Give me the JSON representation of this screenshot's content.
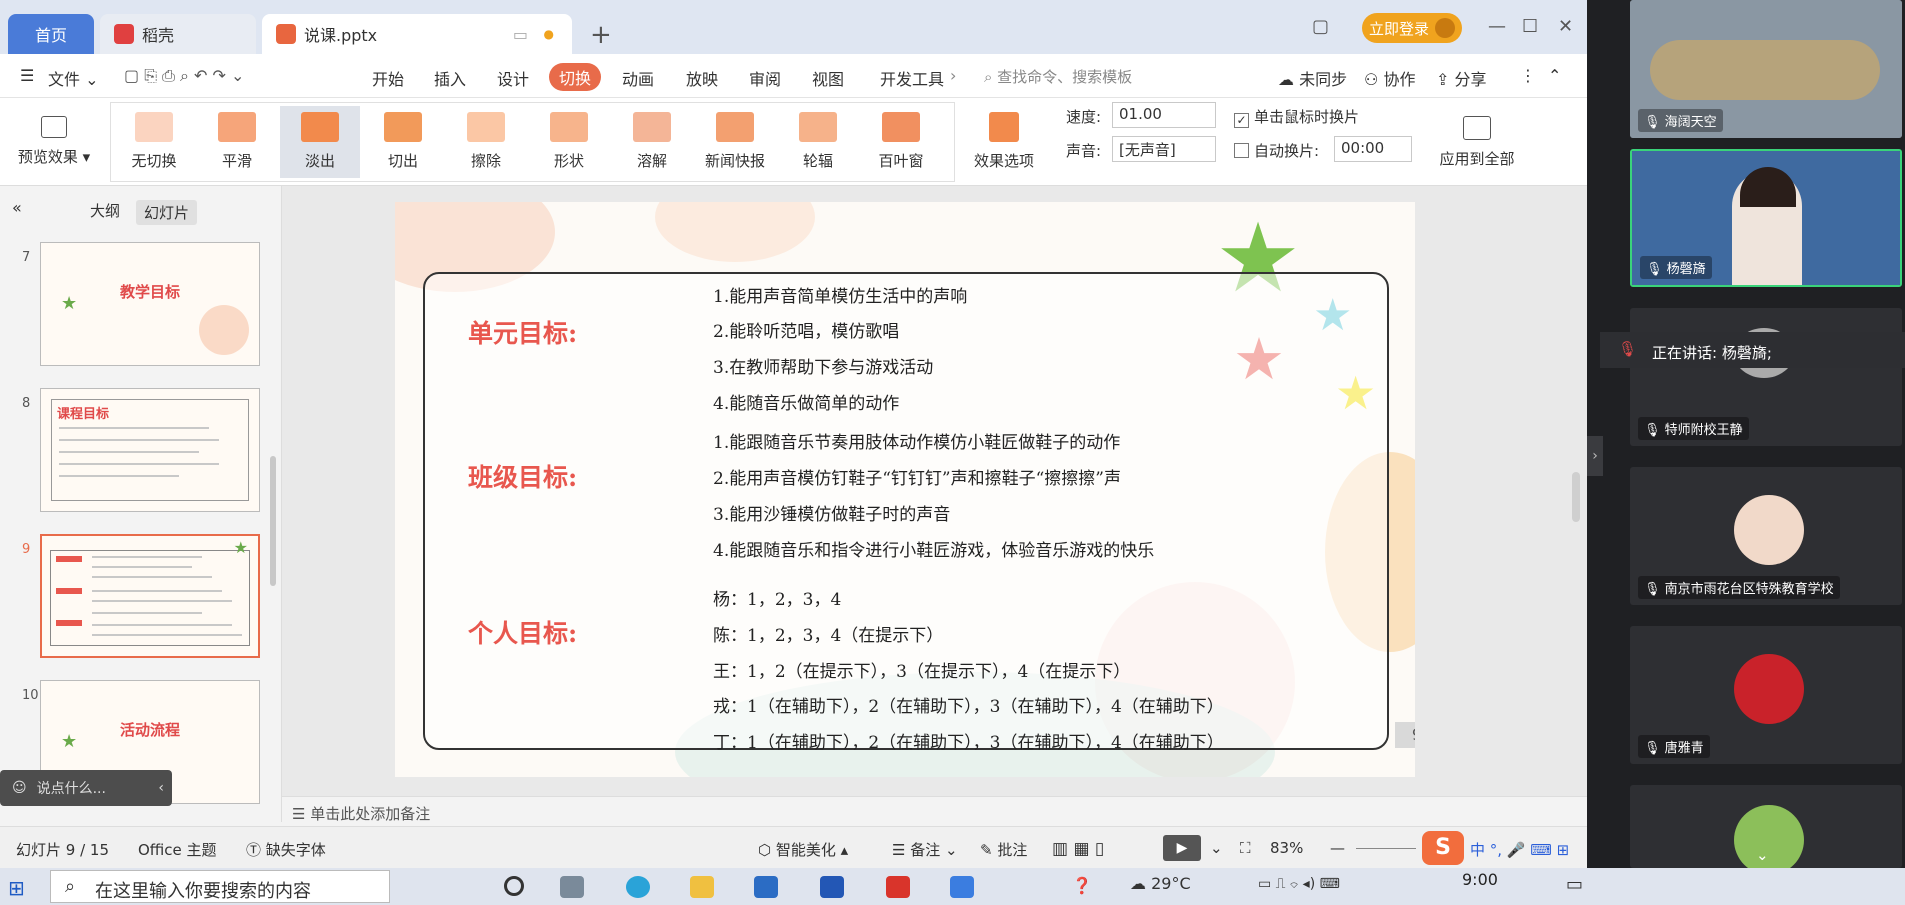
{
  "titlebar": {
    "tab_home": "首页",
    "tab_daoke": "稻壳",
    "tab_file": "说课.pptx",
    "login": "立即登录"
  },
  "menu": {
    "file": "文件",
    "items": [
      "开始",
      "插入",
      "设计",
      "切换",
      "动画",
      "放映",
      "审阅",
      "视图",
      "开发工具"
    ],
    "active": "切换",
    "search_placeholder": "查找命令、搜索模板",
    "unsynced": "未同步",
    "collab": "协作",
    "share": "分享"
  },
  "ribbon": {
    "preview": "预览效果",
    "effects": [
      "无切换",
      "平滑",
      "淡出",
      "切出",
      "擦除",
      "形状",
      "溶解",
      "新闻快报",
      "轮辐",
      "百叶窗"
    ],
    "selected_effect": "淡出",
    "effect_options": "效果选项",
    "speed_label": "速度:",
    "speed_value": "01.00",
    "sound_label": "声音:",
    "sound_value": "[无声音]",
    "on_click": "单击鼠标时换片",
    "auto": "自动换片:",
    "auto_value": "00:00",
    "apply_all": "应用到全部"
  },
  "panel": {
    "tab_outline": "大纲",
    "tab_slides": "幻灯片",
    "slides": [
      {
        "num": "7",
        "title": "教学目标"
      },
      {
        "num": "8",
        "title": "课程目标"
      },
      {
        "num": "9",
        "title": ""
      },
      {
        "num": "10",
        "title": "活动流程"
      }
    ],
    "chat_placeholder": "说点什么..."
  },
  "slide": {
    "unit_title": "单元目标:",
    "unit_lines": [
      "1.能用声音简单模仿生活中的声响",
      "2.能聆听范唱，模仿歌唱",
      "3.在教师帮助下参与游戏活动",
      "4.能随音乐做简单的动作"
    ],
    "class_title": "班级目标:",
    "class_lines": [
      "1.能跟随音乐节奏用肢体动作模仿小鞋匠做鞋子的动作",
      "2.能用声音模仿钉鞋子“钉钉钉”声和擦鞋子“擦擦擦”声",
      "3.能用沙锤模仿做鞋子时的声音",
      "4.能跟随音乐和指令进行小鞋匠游戏，体验音乐游戏的快乐"
    ],
    "personal_title": "个人目标:",
    "personal_lines": [
      "杨：1，2，3，4",
      "陈：1，2，3，4（在提示下）",
      "王：1，2（在提示下），3（在提示下），4（在提示下）",
      "戎：1（在辅助下），2（在辅助下），3（在辅助下），4（在辅助下）",
      "丁：1（在辅助下），2（在辅助下），3（在辅助下），4（在辅助下）"
    ],
    "page": "9"
  },
  "notes": "单击此处添加备注",
  "status": {
    "slide_count": "幻灯片 9 / 15",
    "theme": "Office 主题",
    "missing_font": "缺失字体",
    "beautify": "智能美化",
    "notes": "备注",
    "comment": "批注",
    "zoom": "83%"
  },
  "taskbar": {
    "search": "在这里输入你要搜索的内容",
    "weather": "29°C",
    "time": "9:00",
    "ime": "中"
  },
  "meeting": {
    "participants": [
      "海阔天空",
      "杨磬旖",
      "特师附校王静",
      "南京市雨花台区特殊教育学校",
      "唐雅青"
    ],
    "speaking": "正在讲话: 杨磬旖;"
  },
  "colors": {
    "accent": "#e86b4a",
    "title_red": "#e8574e",
    "home_tab": "#4a7bd8",
    "login": "#f0a31e",
    "active_speaker": "#3ad37a"
  }
}
